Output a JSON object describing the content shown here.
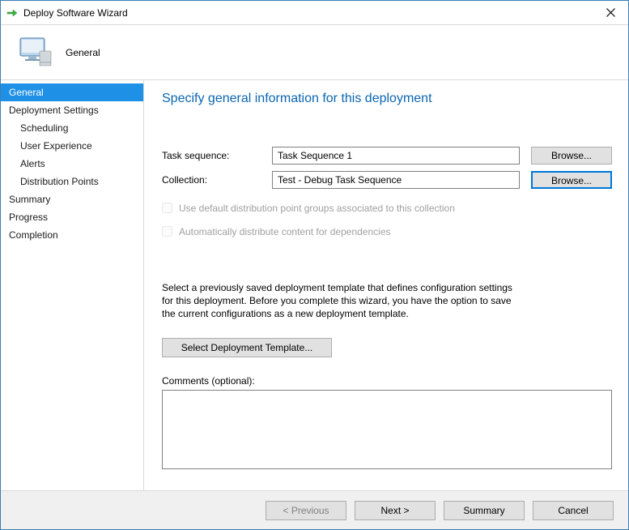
{
  "window": {
    "title": "Deploy Software Wizard"
  },
  "header": {
    "label": "General"
  },
  "sidebar": {
    "items": [
      {
        "label": "General",
        "selected": true,
        "child": false
      },
      {
        "label": "Deployment Settings",
        "selected": false,
        "child": false
      },
      {
        "label": "Scheduling",
        "selected": false,
        "child": true
      },
      {
        "label": "User Experience",
        "selected": false,
        "child": true
      },
      {
        "label": "Alerts",
        "selected": false,
        "child": true
      },
      {
        "label": "Distribution Points",
        "selected": false,
        "child": true
      },
      {
        "label": "Summary",
        "selected": false,
        "child": false
      },
      {
        "label": "Progress",
        "selected": false,
        "child": false
      },
      {
        "label": "Completion",
        "selected": false,
        "child": false
      }
    ]
  },
  "main": {
    "title": "Specify general information for this deployment",
    "task_sequence_label": "Task sequence:",
    "task_sequence_value": "Task Sequence 1",
    "collection_label": "Collection:",
    "collection_value": "Test - Debug Task Sequence",
    "browse_label": "Browse...",
    "check1": "Use default distribution point groups associated to this collection",
    "check2": "Automatically distribute content for dependencies",
    "description": "Select a previously saved deployment template that defines configuration settings for this deployment. Before you complete this wizard, you have the option to save the current configurations as a new deployment template.",
    "template_button": "Select Deployment Template...",
    "comments_label": "Comments (optional):",
    "comments_value": ""
  },
  "footer": {
    "previous": "< Previous",
    "next": "Next >",
    "summary": "Summary",
    "cancel": "Cancel"
  }
}
